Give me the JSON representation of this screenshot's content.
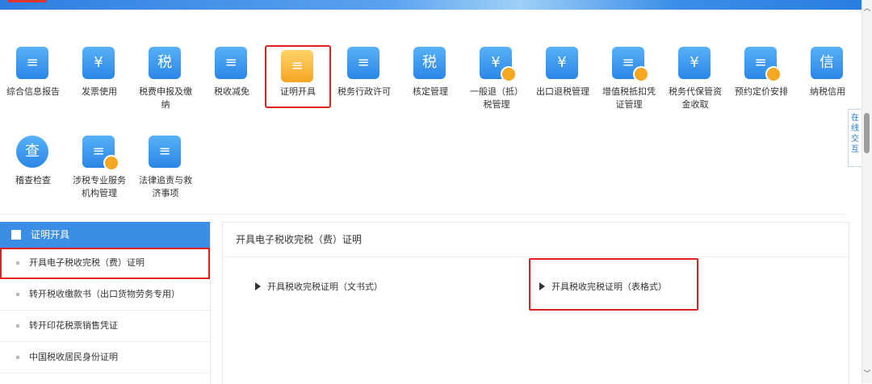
{
  "tiles_row1": [
    {
      "label": "综合信息报告",
      "icon": "report-icon",
      "glyph": "≡"
    },
    {
      "label": "发票使用",
      "icon": "invoice-icon",
      "glyph": "¥"
    },
    {
      "label": "税费申报及缴纳",
      "icon": "tax-payment-icon",
      "glyph": "税"
    },
    {
      "label": "税收减免",
      "icon": "tax-relief-icon",
      "glyph": "≡"
    },
    {
      "label": "证明开具",
      "icon": "certificate-icon",
      "glyph": "≡"
    },
    {
      "label": "税务行政许可",
      "icon": "permit-icon",
      "glyph": "≡"
    },
    {
      "label": "核定管理",
      "icon": "verify-icon",
      "glyph": "税"
    },
    {
      "label": "一般退（抵）税管理",
      "icon": "refund-icon",
      "glyph": "¥"
    },
    {
      "label": "出口退税管理",
      "icon": "export-refund-icon",
      "glyph": "¥"
    },
    {
      "label": "增值税抵扣凭证管理",
      "icon": "vat-deduction-icon",
      "glyph": "≡"
    },
    {
      "label": "税务代保管资金收取",
      "icon": "escrow-icon",
      "glyph": "¥"
    },
    {
      "label": "预约定价安排",
      "icon": "schedule-icon",
      "glyph": "≡"
    },
    {
      "label": "纳税信用",
      "icon": "credit-icon",
      "glyph": "信"
    }
  ],
  "tiles_row2": [
    {
      "label": "稽查检查",
      "icon": "inspection-icon",
      "glyph": "查"
    },
    {
      "label": "涉税专业服务机构管理",
      "icon": "agency-icon",
      "glyph": "≡"
    },
    {
      "label": "法律追责与救济事项",
      "icon": "legal-icon",
      "glyph": "≡"
    }
  ],
  "online_service": [
    "在",
    "线",
    "交",
    "互"
  ],
  "sidebar": {
    "title": "证明开具",
    "items": [
      "开具电子税收完税（费）证明",
      "转开税收缴款书（出口货物劳务专用）",
      "转开印花税票销售凭证",
      "中国税收居民身份证明"
    ]
  },
  "content": {
    "title": "开具电子税收完税（费）证明",
    "options": [
      "开具税收完税证明（文书式）",
      "开具税收完税证明（表格式）"
    ]
  }
}
